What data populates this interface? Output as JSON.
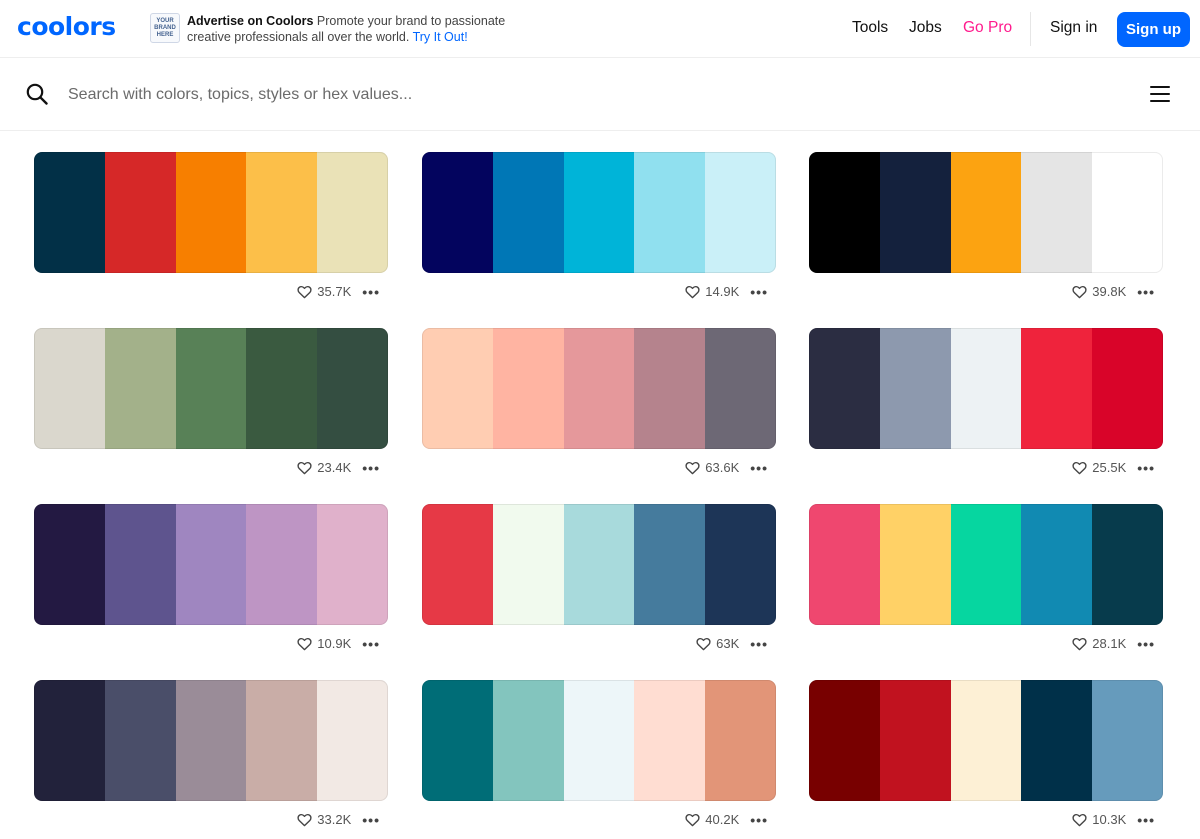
{
  "header": {
    "logo": "coolors",
    "ad": {
      "badge_lines": [
        "YOUR",
        "BRAND",
        "HERE"
      ],
      "title": "Advertise on Coolors",
      "text": "Promote your brand to passionate creative professionals all over the world.",
      "cta": "Try It Out!"
    },
    "nav": {
      "tools": "Tools",
      "jobs": "Jobs",
      "gopro": "Go Pro",
      "signin": "Sign in",
      "signup": "Sign up"
    }
  },
  "search": {
    "placeholder": "Search with colors, topics, styles or hex values...",
    "icon": "search-icon",
    "menu_icon": "hamburger-menu-icon"
  },
  "palettes": [
    {
      "colors": [
        "#023047",
        "#d62828",
        "#f77f00",
        "#fcbf49",
        "#eae2b7"
      ],
      "likes": "35.7K"
    },
    {
      "colors": [
        "#03045e",
        "#0077b6",
        "#00b4d8",
        "#90e0ef",
        "#caf0f8"
      ],
      "likes": "14.9K"
    },
    {
      "colors": [
        "#000000",
        "#14213d",
        "#fca311",
        "#e5e5e5",
        "#ffffff"
      ],
      "likes": "39.8K"
    },
    {
      "colors": [
        "#dad7cd",
        "#a3b18a",
        "#588157",
        "#3a5a40",
        "#344e41"
      ],
      "likes": "23.4K"
    },
    {
      "colors": [
        "#ffcdb2",
        "#ffb4a2",
        "#e5989b",
        "#b5838d",
        "#6d6875"
      ],
      "likes": "63.6K"
    },
    {
      "colors": [
        "#2b2d42",
        "#8d99ae",
        "#edf2f4",
        "#ef233c",
        "#d90429"
      ],
      "likes": "25.5K"
    },
    {
      "colors": [
        "#231942",
        "#5e548e",
        "#9f86c0",
        "#be95c4",
        "#e0b1cb"
      ],
      "likes": "10.9K"
    },
    {
      "colors": [
        "#e63946",
        "#f1faee",
        "#a8dadc",
        "#457b9d",
        "#1d3557"
      ],
      "likes": "63K"
    },
    {
      "colors": [
        "#ef476f",
        "#ffd166",
        "#06d6a0",
        "#118ab2",
        "#073b4c"
      ],
      "likes": "28.1K"
    },
    {
      "colors": [
        "#22223b",
        "#4a4e69",
        "#9a8c98",
        "#c9ada7",
        "#f2e9e4"
      ],
      "likes": "33.2K"
    },
    {
      "colors": [
        "#006d77",
        "#83c5be",
        "#edf6f9",
        "#ffddd2",
        "#e29578"
      ],
      "likes": "40.2K"
    },
    {
      "colors": [
        "#780000",
        "#c1121f",
        "#fdf0d5",
        "#003049",
        "#669bbc"
      ],
      "likes": "10.3K"
    }
  ],
  "colors": {
    "brand": "#0066ff",
    "gopro": "#ff1b8d"
  }
}
